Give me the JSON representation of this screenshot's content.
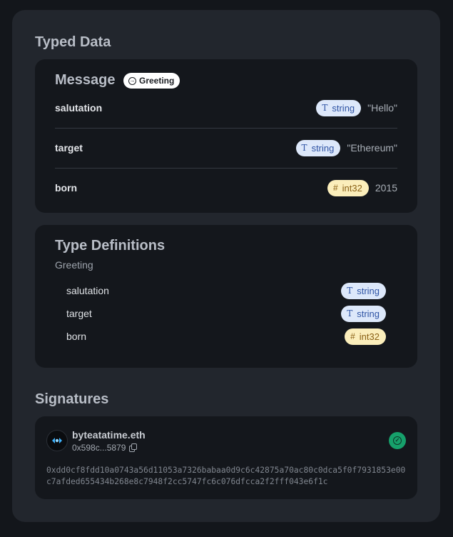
{
  "typed_data": {
    "title": "Typed Data",
    "message": {
      "title": "Message",
      "type_chip": "Greeting",
      "fields": [
        {
          "name": "salutation",
          "type": "string",
          "value": "\"Hello\""
        },
        {
          "name": "target",
          "type": "string",
          "value": "\"Ethereum\""
        },
        {
          "name": "born",
          "type": "int32",
          "value": "2015"
        }
      ]
    },
    "type_definitions": {
      "title": "Type Definitions",
      "type_name": "Greeting",
      "fields": [
        {
          "name": "salutation",
          "type": "string"
        },
        {
          "name": "target",
          "type": "string"
        },
        {
          "name": "born",
          "type": "int32"
        }
      ]
    }
  },
  "signatures": {
    "title": "Signatures",
    "items": [
      {
        "name": "byteatatime.eth",
        "address_short": "0x598c...5879",
        "signature": "0xdd0cf8fdd10a0743a56d11053a7326babaa0d9c6c42875a70ac80c0dca5f0f7931853e00c7afded655434b268e8c7948f2cc5747fc6c076dfcca2f2fff043e6f1c",
        "verified": true
      }
    ]
  },
  "icons": {
    "string_type": "text-type-icon",
    "int_type": "hash-icon",
    "struct_type": "arrow-circle-icon",
    "copy": "copy-icon",
    "verified": "check-circle-icon"
  },
  "colors": {
    "string_badge_bg": "#dde8fa",
    "string_badge_fg": "#2f54a4",
    "int_badge_bg": "#fbeebb",
    "int_badge_fg": "#8a6116",
    "verified": "#16a06b"
  }
}
